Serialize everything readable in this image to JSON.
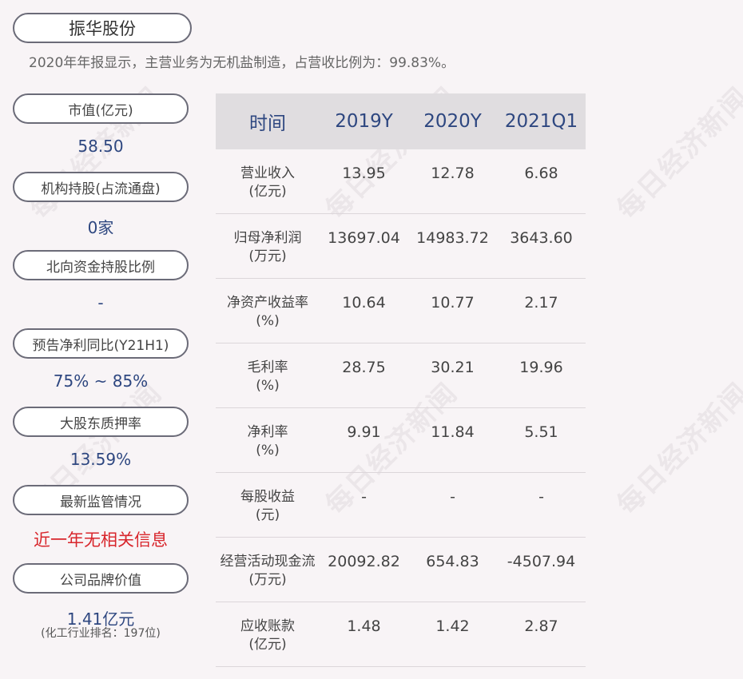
{
  "company": "振华股份",
  "summary": "2020年年报显示，主营业务为无机盐制造，占营收比例为：99.83%。",
  "watermark": "每日经济新闻",
  "metrics": [
    {
      "label": "市值(亿元)",
      "value": "58.50"
    },
    {
      "label": "机构持股(占流通盘)",
      "value": "0家"
    },
    {
      "label": "北向资金持股比例",
      "value": "-"
    },
    {
      "label": "预告净利同比(Y21H1)",
      "value": "75% ~ 85%"
    },
    {
      "label": "大股东质押率",
      "value": "13.59%"
    },
    {
      "label": "最新监管情况",
      "value": "近一年无相关信息"
    },
    {
      "label": "公司品牌价值",
      "value": "1.41亿元",
      "note": "(化工行业排名：197位)"
    }
  ],
  "table": {
    "headers": [
      "时间",
      "2019Y",
      "2020Y",
      "2021Q1"
    ],
    "rows": [
      {
        "label1": "营业收入",
        "label2": "(亿元)",
        "values": [
          "13.95",
          "12.78",
          "6.68"
        ]
      },
      {
        "label1": "归母净利润",
        "label2": "(万元)",
        "values": [
          "13697.04",
          "14983.72",
          "3643.60"
        ]
      },
      {
        "label1": "净资产收益率",
        "label2": "(%)",
        "values": [
          "10.64",
          "10.77",
          "2.17"
        ]
      },
      {
        "label1": "毛利率",
        "label2": "(%)",
        "values": [
          "28.75",
          "30.21",
          "19.96"
        ]
      },
      {
        "label1": "净利率",
        "label2": "(%)",
        "values": [
          "9.91",
          "11.84",
          "5.51"
        ]
      },
      {
        "label1": "每股收益",
        "label2": "(元)",
        "values": [
          "-",
          "-",
          "-"
        ]
      },
      {
        "label1": "经营活动现金流",
        "label2": "(万元)",
        "values": [
          "20092.82",
          "654.83",
          "-4507.94"
        ]
      },
      {
        "label1": "应收账款",
        "label2": "(亿元)",
        "values": [
          "1.48",
          "1.42",
          "2.87"
        ]
      }
    ]
  }
}
